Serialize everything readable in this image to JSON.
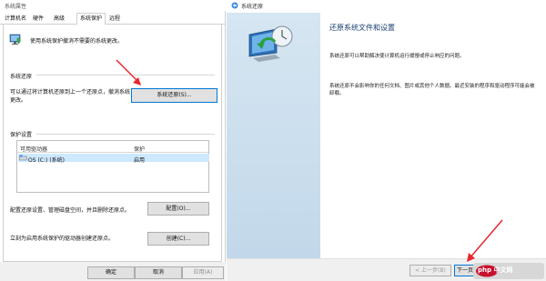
{
  "left_dialog": {
    "title": "系统属性",
    "tabs": [
      "计算机名",
      "硬件",
      "高级",
      "系统保护",
      "远程"
    ],
    "active_tab": "系统保护",
    "intro": "使用系统保护撤消不需要的系统更改。",
    "restore_section": {
      "title": "系统还原",
      "desc": "可以通过将计算机还原到上一个还原点，撤消系统更改。",
      "button": "系统还原(S)..."
    },
    "protection_section": {
      "title": "保护设置",
      "col_drive": "可用驱动器",
      "col_protection": "保护",
      "drive": "OS (C:) (系统)",
      "status": "启用"
    },
    "configure_desc": "配置还原设置、管理磁盘空间，并且删除还原点。",
    "configure_button": "配置(O)...",
    "create_desc": "立刻为启用系统保护的驱动器创建还原点。",
    "create_button": "创建(C)...",
    "ok": "确定",
    "cancel": "取消",
    "apply": "应用(A)"
  },
  "right_wizard": {
    "title": "系统还原",
    "heading": "还原系统文件和设置",
    "p1": "系统还原可以帮助解决使计算机运行缓慢或停止响应的问题。",
    "p2": "系统还原不会影响你的任何文档、图片或其他个人数据。最近安装的程序和驱动程序可能会被卸载。",
    "back": "< 上一步(B)",
    "next": "下一页",
    "watermark": "php 中文网"
  },
  "colors": {
    "accent": "#0078d7",
    "arrow": "#e8262f",
    "selection": "#cde8ff"
  }
}
